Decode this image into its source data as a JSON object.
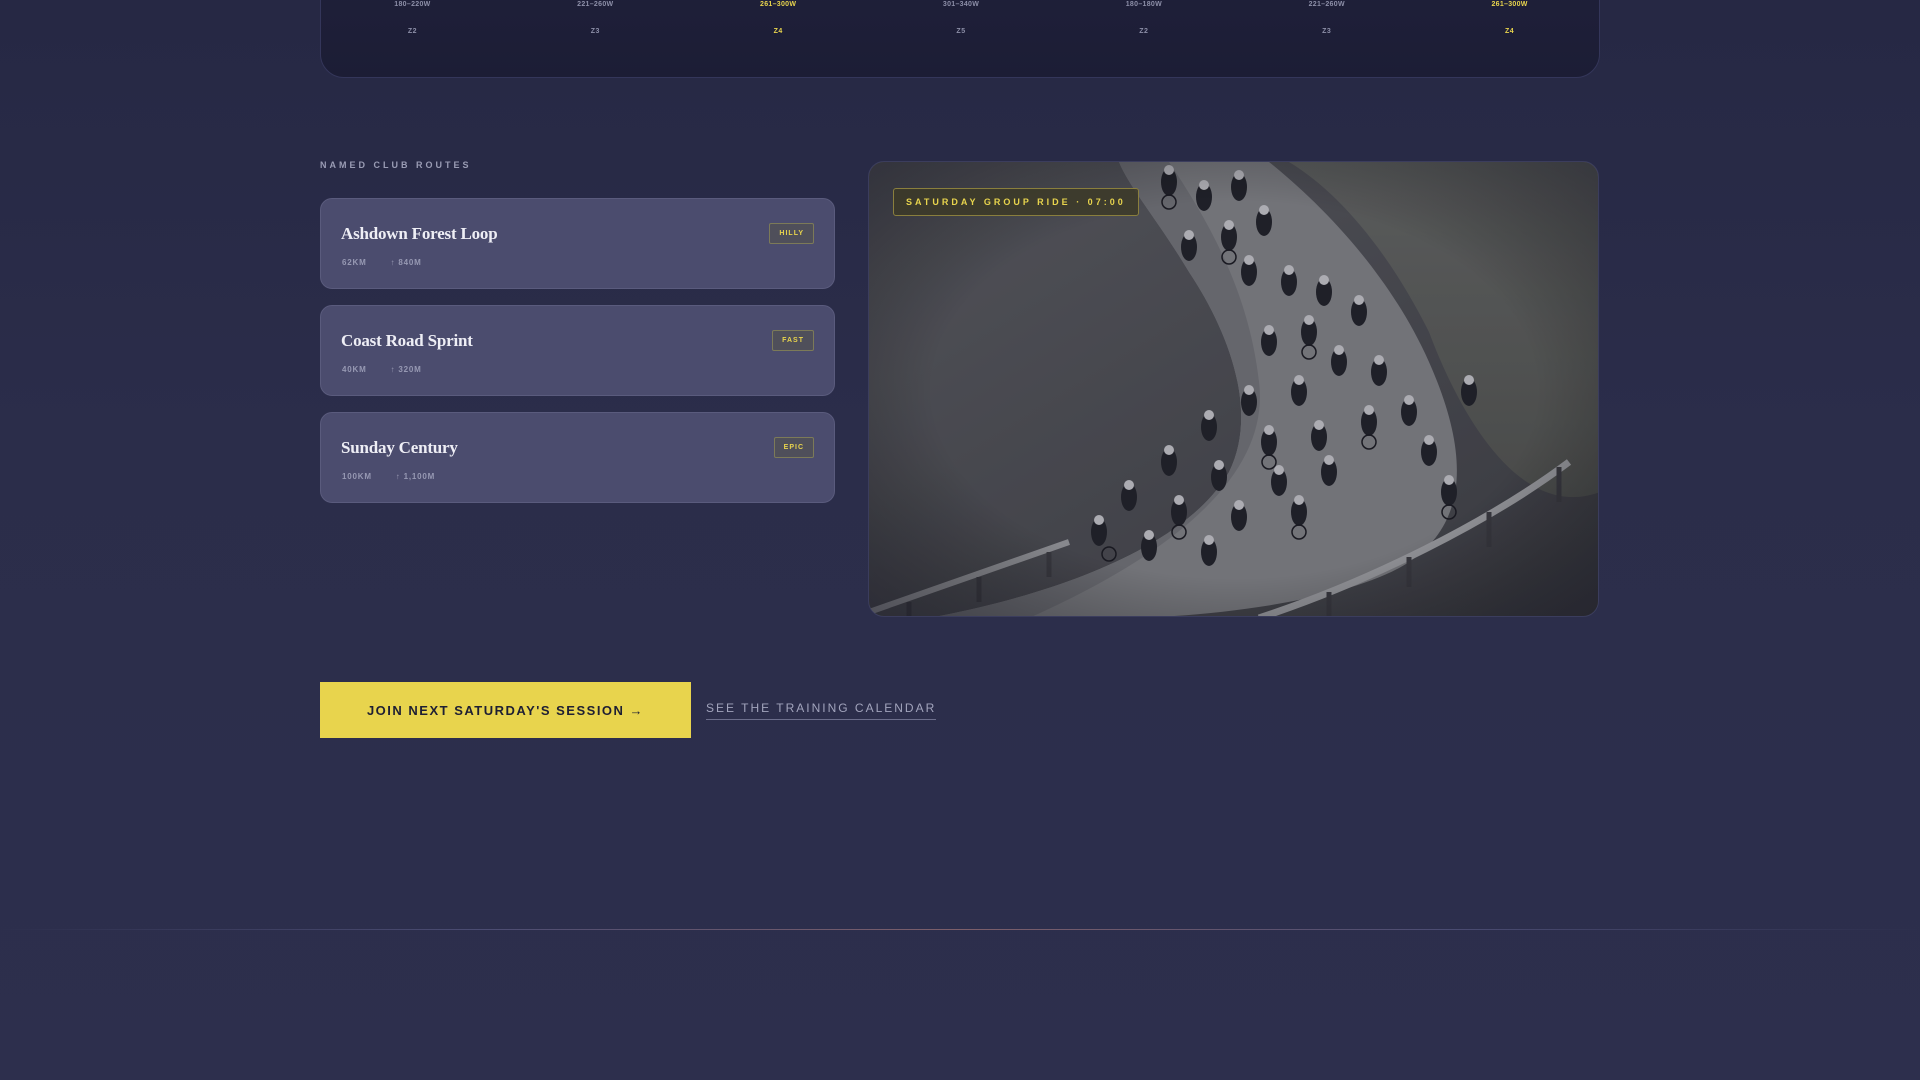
{
  "zones": [
    {
      "range": "180–220W",
      "zone": "Z2",
      "highlight": false
    },
    {
      "range": "221–260W",
      "zone": "Z3",
      "highlight": false
    },
    {
      "range": "261–300W",
      "zone": "Z4",
      "highlight": true
    },
    {
      "range": "301–340W",
      "zone": "Z5",
      "highlight": false
    },
    {
      "range": "180–180W",
      "zone": "Z2",
      "highlight": false
    },
    {
      "range": "221–260W",
      "zone": "Z3",
      "highlight": false
    },
    {
      "range": "261–300W",
      "zone": "Z4",
      "highlight": true
    }
  ],
  "routes_section": {
    "label": "NAMED CLUB ROUTES",
    "items": [
      {
        "name": "Ashdown Forest Loop",
        "distance": "62KM",
        "climb": "↑ 840M",
        "tag": "HILLY"
      },
      {
        "name": "Coast Road Sprint",
        "distance": "40KM",
        "climb": "↑ 320M",
        "tag": "FAST"
      },
      {
        "name": "Sunday Century",
        "distance": "100KM",
        "climb": "↑ 1,100M",
        "tag": "EPIC"
      }
    ]
  },
  "photo": {
    "tag": "SATURDAY GROUP RIDE · 07:00"
  },
  "cta": {
    "primary_label": "JOIN NEXT SATURDAY'S SESSION →",
    "secondary_label": "SEE THE TRAINING CALENDAR"
  },
  "colors": {
    "accent": "#e8d44d",
    "background": "#2b2d4a",
    "card": "#4b4c6e"
  }
}
